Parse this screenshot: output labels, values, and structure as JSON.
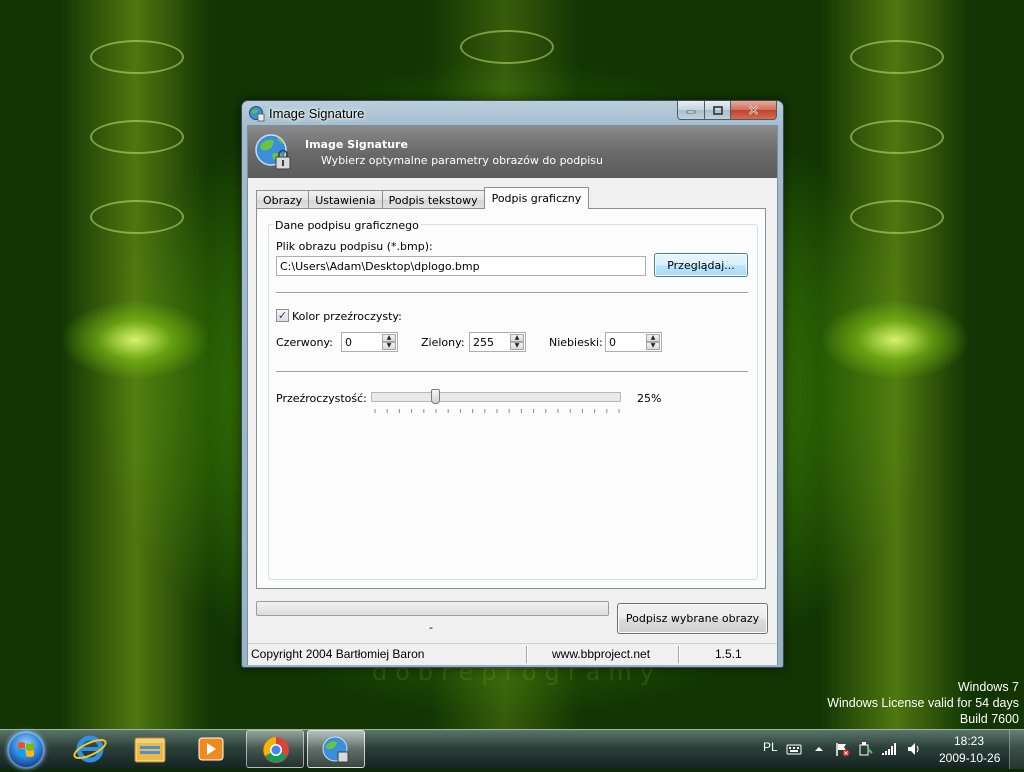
{
  "desktop": {
    "watermark": "dobreprogramy",
    "windows_info": {
      "line1": "Windows 7",
      "line2": "Windows License valid for 54 days",
      "line3": "Build 7600"
    }
  },
  "window": {
    "title": "Image Signature",
    "header": {
      "title": "Image Signature",
      "subtitle": "Wybierz optymalne parametry obrazów do podpisu"
    },
    "tabs": [
      {
        "label": "Obrazy",
        "active": false
      },
      {
        "label": "Ustawienia",
        "active": false
      },
      {
        "label": "Podpis tekstowy",
        "active": false
      },
      {
        "label": "Podpis graficzny",
        "active": true
      }
    ],
    "graphic_signature": {
      "group_title": "Dane podpisu graficznego",
      "file_label": "Plik obrazu podpisu (*.bmp):",
      "file_path": "C:\\Users\\Adam\\Desktop\\dplogo.bmp",
      "browse_label": "Przeglądaj...",
      "transparent_color": {
        "label": "Kolor przeźroczysty:",
        "checked": true
      },
      "red": {
        "label": "Czerwony:",
        "value": "0"
      },
      "green": {
        "label": "Zielony:",
        "value": "255"
      },
      "blue": {
        "label": "Niebieski:",
        "value": "0"
      },
      "transparency": {
        "label": "Przeźroczystość:",
        "value_text": "25%",
        "value": 25
      }
    },
    "progress": {
      "value": 0,
      "status_text": "-"
    },
    "sign_button_label": "Podpisz wybrane obrazy",
    "statusbar": {
      "copyright": "Copyright 2004 Bartłomiej Baron",
      "website": "www.bbproject.net",
      "version": "1.5.1"
    }
  },
  "taskbar": {
    "pinned": [
      {
        "name": "internet-explorer-icon"
      },
      {
        "name": "windows-explorer-icon"
      },
      {
        "name": "media-player-icon"
      },
      {
        "name": "chrome-icon"
      },
      {
        "name": "image-signature-icon"
      }
    ],
    "tray": {
      "language": "PL",
      "time": "18:23",
      "date": "2009-10-26"
    }
  },
  "colors": {
    "header_bg": "#6a6a6a",
    "progress_fill": "#1c9e2a",
    "wallpaper_accent": "#b8e20e"
  }
}
